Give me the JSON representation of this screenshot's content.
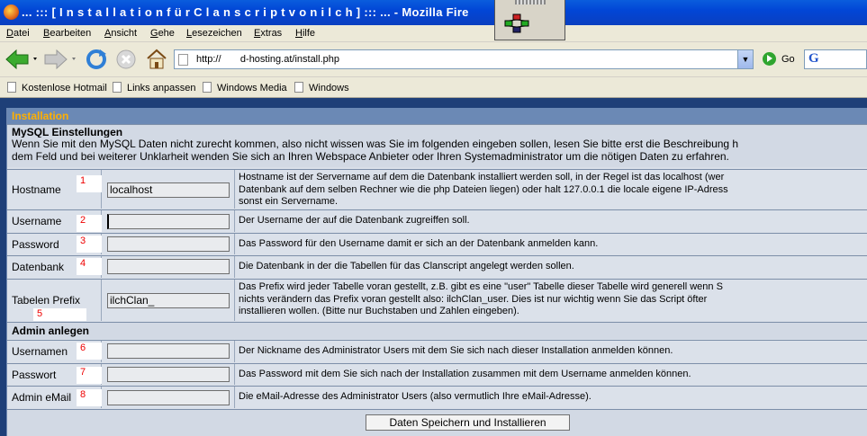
{
  "window": {
    "title": "... ::: [ I n s t a l l a t i o n   f ü r   C l a n s c r i p t   v o n   i l c h ] ::: ... - Mozilla Fire"
  },
  "menubar": [
    "Datei",
    "Bearbeiten",
    "Ansicht",
    "Gehe",
    "Lesezeichen",
    "Extras",
    "Hilfe"
  ],
  "navbar": {
    "url": "http://       d-hosting.at/install.php",
    "go_label": "Go",
    "search_logo": "G"
  },
  "bookmarks": [
    "Kostenlose Hotmail",
    "Links anpassen",
    "Windows Media",
    "Windows"
  ],
  "installation": {
    "header": "Installation",
    "mysql_title": "MySQL Einstellungen",
    "mysql_intro": "Wenn Sie mit den MySQL Daten nicht zurecht kommen, also nicht wissen was Sie im folgenden eingeben sollen, lesen Sie bitte erst die Beschreibung h\ndem Feld und bei weiterer Unklarheit wenden Sie sich an Ihren Webspace Anbieter oder Ihren Systemadministrator um die nötigen Daten zu erfahren.",
    "fields": [
      {
        "label": "Hostname",
        "num": "1",
        "value": "localhost",
        "desc": "Hostname ist der Servername auf dem die Datenbank installiert werden soll, in der Regel ist das localhost (wer\nDatenbank auf dem selben Rechner wie die php Dateien liegen) oder halt 127.0.0.1 die locale eigene IP-Adress\nsonst ein Servername."
      },
      {
        "label": "Username",
        "num": "2",
        "value": "",
        "desc": "Der Username der auf die Datenbank zugreiffen soll."
      },
      {
        "label": "Password",
        "num": "3",
        "value": "",
        "desc": "Das Password für den Username damit er sich an der Datenbank anmelden kann."
      },
      {
        "label": "Datenbank",
        "num": "4",
        "value": "",
        "desc": "Die Datenbank in der die Tabellen für das Clanscript angelegt werden sollen."
      },
      {
        "label": "Tabelen Prefix",
        "num": "5",
        "value": "ilchClan_",
        "desc": "Das Prefix wird jeder Tabelle voran gestellt, z.B. gibt es eine \"user\" Tabelle dieser Tabelle wird generell wenn S\nnichts verändern das Prefix voran gestellt also: ilchClan_user. Dies ist nur wichtig wenn Sie das Script öfter\ninstallieren wollen. (Bitte nur Buchstaben und Zahlen eingeben)."
      }
    ],
    "admin_title": "Admin anlegen",
    "admin_fields": [
      {
        "label": "Usernamen",
        "num": "6",
        "value": "",
        "desc": "Der Nickname des Administrator Users mit dem Sie sich nach dieser Installation anmelden können."
      },
      {
        "label": "Passwort",
        "num": "7",
        "value": "",
        "desc": "Das Password mit dem Sie sich nach der Installation zusammen mit dem Username anmelden können."
      },
      {
        "label": "Admin eMail",
        "num": "8",
        "value": "",
        "desc": "Die eMail-Adresse des Administrator Users (also vermutlich Ihre eMail-Adresse)."
      }
    ],
    "submit_label": "Daten Speichern und Installieren"
  },
  "colors": {
    "section_header_bg": "#6b89b5",
    "section_header_text": "#ffb000",
    "annotation_numbers": "#e00000",
    "page_bg": "#1e3f78"
  },
  "icons": [
    "firefox-icon",
    "back-icon",
    "forward-icon",
    "reload-icon",
    "stop-icon",
    "home-icon",
    "go-icon",
    "bookmark-page-icon",
    "extension-icon"
  ]
}
